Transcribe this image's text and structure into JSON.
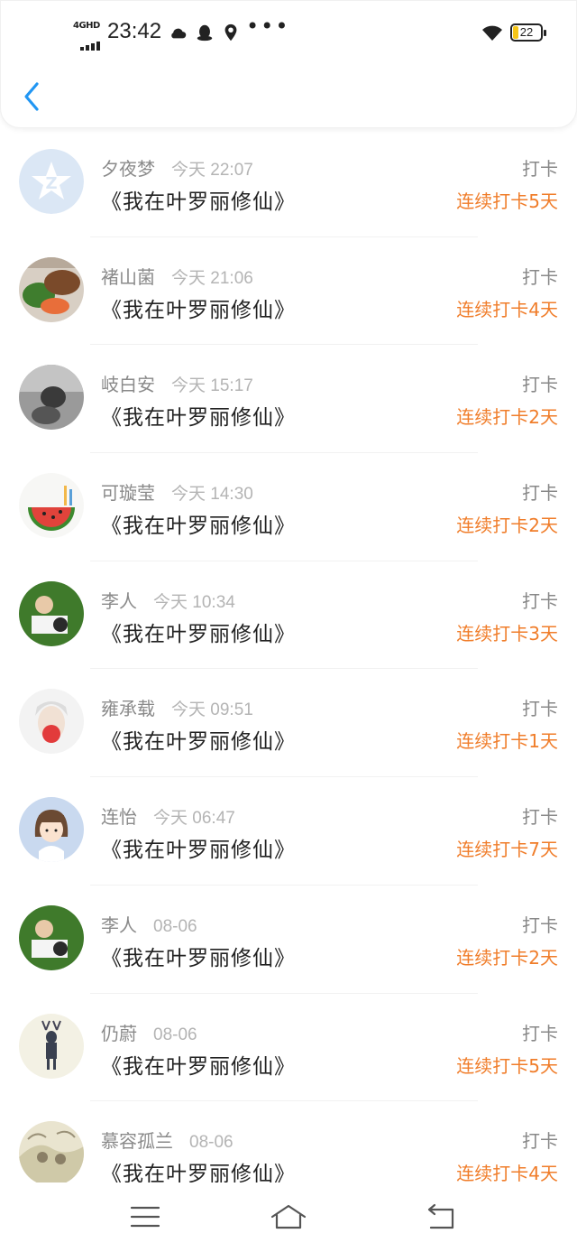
{
  "status_bar": {
    "network": "4GHD",
    "time": "23:42",
    "battery": "22",
    "more": "•••"
  },
  "colors": {
    "accent": "#f07d2a",
    "back_arrow": "#2196f3"
  },
  "checkins": [
    {
      "name": "夕夜梦",
      "time": "今天 22:07",
      "book": "《我在叶罗丽修仙》",
      "tag": "打卡",
      "streak": "连续打卡5天",
      "avatar": "qzone-default-avatar"
    },
    {
      "name": "褚山菌",
      "time": "今天 21:06",
      "book": "《我在叶罗丽修仙》",
      "tag": "打卡",
      "streak": "连续打卡4天",
      "avatar": "food-avatar"
    },
    {
      "name": "岐白安",
      "time": "今天 15:17",
      "book": "《我在叶罗丽修仙》",
      "tag": "打卡",
      "streak": "连续打卡2天",
      "avatar": "grayscale-photo-avatar"
    },
    {
      "name": "可璇莹",
      "time": "今天 14:30",
      "book": "《我在叶罗丽修仙》",
      "tag": "打卡",
      "streak": "连续打卡2天",
      "avatar": "watermelon-avatar"
    },
    {
      "name": "李人",
      "time": "今天 10:34",
      "book": "《我在叶罗丽修仙》",
      "tag": "打卡",
      "streak": "连续打卡3天",
      "avatar": "grass-people-avatar"
    },
    {
      "name": "雍承载",
      "time": "今天 09:51",
      "book": "《我在叶罗丽修仙》",
      "tag": "打卡",
      "streak": "连续打卡1天",
      "avatar": "white-hair-avatar"
    },
    {
      "name": "连怡",
      "time": "今天 06:47",
      "book": "《我在叶罗丽修仙》",
      "tag": "打卡",
      "streak": "连续打卡7天",
      "avatar": "cartoon-girl-avatar"
    },
    {
      "name": "李人",
      "time": "08-06",
      "book": "《我在叶罗丽修仙》",
      "tag": "打卡",
      "streak": "连续打卡2天",
      "avatar": "grass-people-avatar"
    },
    {
      "name": "仍蔚",
      "time": "08-06",
      "book": "《我在叶罗丽修仙》",
      "tag": "打卡",
      "streak": "连续打卡5天",
      "avatar": "deer-avatar"
    },
    {
      "name": "慕容孤兰",
      "time": "08-06",
      "book": "《我在叶罗丽修仙》",
      "tag": "打卡",
      "streak": "连续打卡4天",
      "avatar": "sketch-avatar"
    }
  ]
}
